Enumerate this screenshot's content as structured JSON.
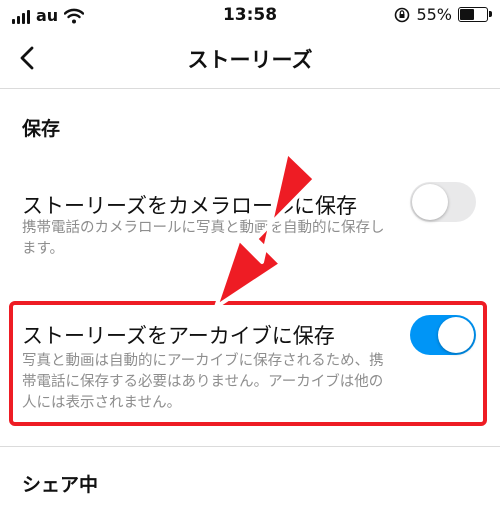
{
  "status_bar": {
    "carrier": "au",
    "time": "13:58",
    "battery": "55%",
    "battery_level": 0.55
  },
  "nav": {
    "title": "ストーリーズ"
  },
  "sections": {
    "save": {
      "title": "保存",
      "camera_roll": {
        "title": "ストーリーズをカメラロールに保存",
        "description": "携帯電話のカメラロールに写真と動画を自動的に保存します。",
        "enabled": false
      },
      "archive": {
        "title": "ストーリーズをアーカイブに保存",
        "description": "写真と動画は自動的にアーカイブに保存されるため、携帯電話に保存する必要はありません。アーカイブは他の人には表示されません。",
        "enabled": true
      }
    },
    "sharing": {
      "title": "シェア中"
    }
  },
  "colors": {
    "highlight": "#ee1c24",
    "toggle_on": "#0095f6",
    "toggle_off": "#e9e9ea"
  }
}
